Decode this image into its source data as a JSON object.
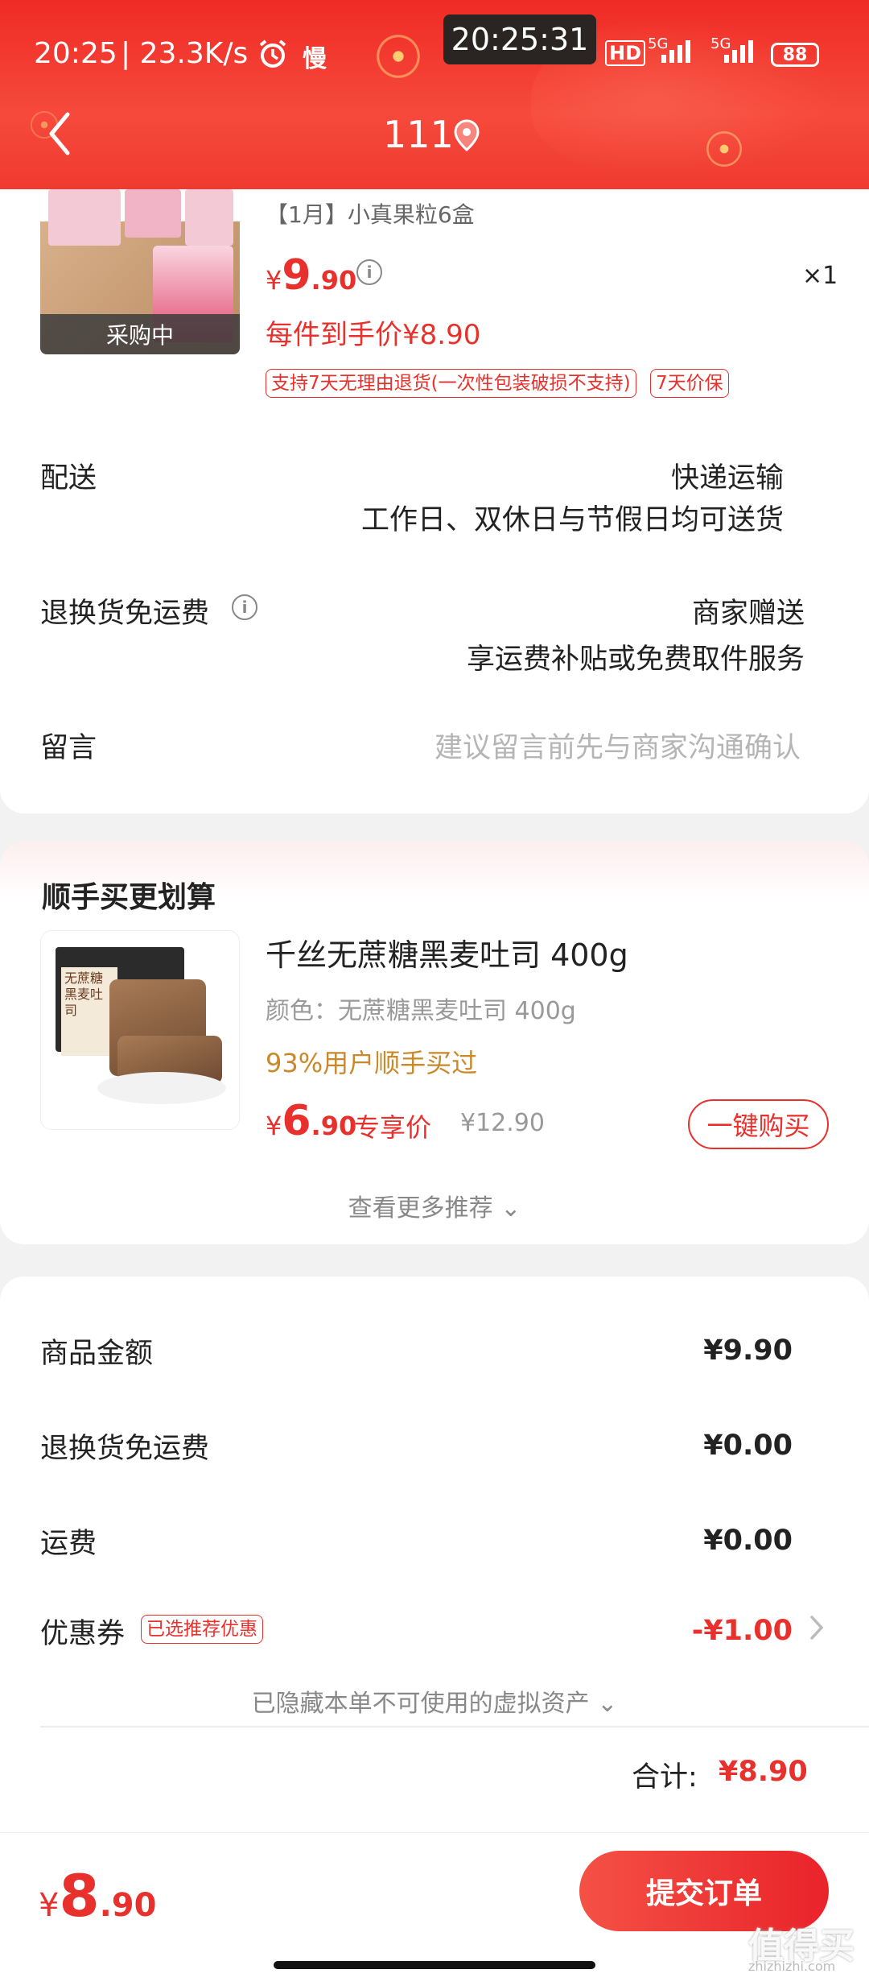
{
  "status_bar": {
    "time": "20:25",
    "net_speed": "| 23.3K/s",
    "slow_label": "慢",
    "clock_overlay": "20:25:31",
    "hd_label": "HD",
    "signal1": "5G",
    "signal2": "5G",
    "battery": "88"
  },
  "header": {
    "title": "111"
  },
  "order_item": {
    "name": "【1月】小真果粒6盒",
    "status_badge": "采购中",
    "price_currency": "¥",
    "price_int": "9",
    "price_dec": ".90",
    "quantity": "×1",
    "final_price": "每件到手价¥8.90",
    "tags": [
      "支持7天无理由退货(一次性包装破损不支持)",
      "7天价保"
    ]
  },
  "delivery": {
    "label": "配送",
    "method": "快递运输",
    "detail": "工作日、双休日与节假日均可送货"
  },
  "return_shipping": {
    "label": "退换货免运费",
    "value": "商家赠送",
    "detail": "享运费补贴或免费取件服务"
  },
  "message": {
    "label": "留言",
    "placeholder": "建议留言前先与商家沟通确认"
  },
  "addon": {
    "section_title": "顺手买更划算",
    "name": "千丝无蔗糖黑麦吐司 400g",
    "variant": "颜色：无蔗糖黑麦吐司 400g",
    "popularity": "93%用户顺手买过",
    "price_currency": "¥",
    "price_int": "6",
    "price_dec": ".90",
    "price_label": "专享价",
    "original_price": "¥12.90",
    "buy_button": "一键购买",
    "more": "查看更多推荐 ⌄",
    "package_text": "无蔗糖 黑麦吐司"
  },
  "summary": {
    "goods_label": "商品金额",
    "goods_value": "¥9.90",
    "return_label": "退换货免运费",
    "return_value": "¥0.00",
    "shipping_label": "运费",
    "shipping_value": "¥0.00",
    "coupon_label": "优惠券",
    "coupon_tag": "已选推荐优惠",
    "coupon_value": "-¥1.00",
    "hidden_assets": "已隐藏本单不可使用的虚拟资产 ⌄",
    "total_label": "合计:",
    "total_value": "¥8.90"
  },
  "bottom": {
    "price_currency": "¥",
    "price_int": "8",
    "price_dec": ".90",
    "submit_label": "提交订单",
    "watermark": "值得买",
    "watermark_url": "zhizhizhi.com"
  },
  "colors": {
    "accent": "#e8312c",
    "header": "#ef2b25",
    "muted": "#999999"
  }
}
